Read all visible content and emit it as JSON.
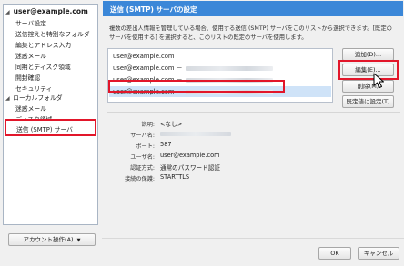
{
  "sidebar": {
    "account_name": "user@example.com",
    "account_children": [
      "サーバ設定",
      "送信控えと特別なフォルダ",
      "編集とアドレス入力",
      "迷惑メール",
      "同期とディスク領域",
      "開封確認",
      "セキュリティ"
    ],
    "local_folders": "ローカルフォルダ",
    "local_children": [
      "迷惑メール",
      "ディスク領域"
    ],
    "smtp_item": "送信 (SMTP) サーバ",
    "account_actions_label": "アカウント操作(A)"
  },
  "main": {
    "title": "送信 (SMTP) サーバの設定",
    "description": [
      "複数の差出人情報を管理している場合、使用する送信 (SMTP) サーバをこのリストから選択できます。[既定の",
      "サーバを使用する] を選択すると、このリストの既定のサーバを使用します。"
    ],
    "servers": [
      {
        "email": "user@example.com",
        "suffix": ""
      },
      {
        "email": "user@example.com",
        "suffix": "－"
      },
      {
        "email": "user@example.com",
        "suffix": "－"
      },
      {
        "email": "user@example.com",
        "suffix": "－"
      }
    ],
    "buttons": {
      "add": "追加(D)...",
      "edit": "編集(E)...",
      "delete": "削除(M)",
      "set_default": "既定値に設定(T)"
    },
    "details": [
      {
        "label": "説明:",
        "value": "<なし>"
      },
      {
        "label": "サーバ名:",
        "value": ""
      },
      {
        "label": "ポート:",
        "value": "587"
      },
      {
        "label": "ユーザ名:",
        "value": "user@example.com"
      },
      {
        "label": "認証方式:",
        "value": "通常のパスワード認証"
      },
      {
        "label": "接続の保護:",
        "value": "STARTTLS"
      }
    ],
    "ok": "OK",
    "cancel": "キャンセル"
  }
}
